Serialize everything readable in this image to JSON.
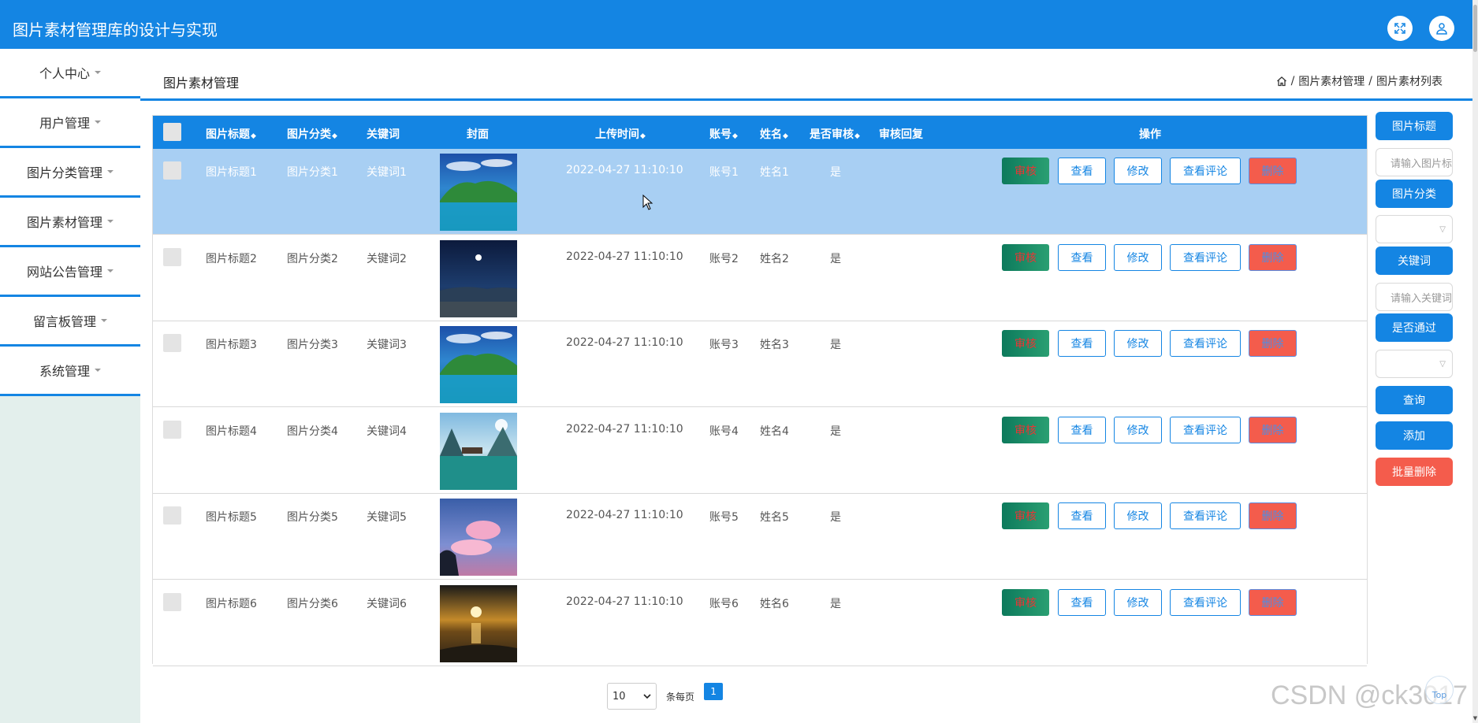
{
  "app": {
    "title": "图片素材管理库的设计与实现"
  },
  "sidebar": {
    "items": [
      {
        "label": "个人中心"
      },
      {
        "label": "用户管理"
      },
      {
        "label": "图片分类管理"
      },
      {
        "label": "图片素材管理"
      },
      {
        "label": "网站公告管理"
      },
      {
        "label": "留言板管理"
      },
      {
        "label": "系统管理"
      }
    ]
  },
  "page": {
    "title": "图片素材管理",
    "breadcrumb": [
      "图片素材管理",
      "图片素材列表"
    ]
  },
  "table": {
    "columns": {
      "title": "图片标题",
      "category": "图片分类",
      "keyword": "关键词",
      "cover": "封面",
      "upload_time": "上传时间",
      "account": "账号",
      "name": "姓名",
      "audited": "是否审核",
      "audit_reply": "审核回复",
      "actions": "操作"
    },
    "sort_glyph": "◆",
    "actions": {
      "audit": "审核",
      "view": "查看",
      "edit": "修改",
      "comments": "查看评论",
      "delete": "删除"
    },
    "rows": [
      {
        "title": "图片标题1",
        "category": "图片分类1",
        "keyword": "关键词1",
        "upload_time": "2022-04-27 11:10:10",
        "account": "账号1",
        "name": "姓名1",
        "audited": "是",
        "cover_theme": "lake-island",
        "selected": true
      },
      {
        "title": "图片标题2",
        "category": "图片分类2",
        "keyword": "关键词2",
        "upload_time": "2022-04-27 11:10:10",
        "account": "账号2",
        "name": "姓名2",
        "audited": "是",
        "cover_theme": "night-sky",
        "selected": false
      },
      {
        "title": "图片标题3",
        "category": "图片分类3",
        "keyword": "关键词3",
        "upload_time": "2022-04-27 11:10:10",
        "account": "账号3",
        "name": "姓名3",
        "audited": "是",
        "cover_theme": "lake-island",
        "selected": false
      },
      {
        "title": "图片标题4",
        "category": "图片分类4",
        "keyword": "关键词4",
        "upload_time": "2022-04-27 11:10:10",
        "account": "账号4",
        "name": "姓名4",
        "audited": "是",
        "cover_theme": "mountain-lake",
        "selected": false
      },
      {
        "title": "图片标题5",
        "category": "图片分类5",
        "keyword": "关键词5",
        "upload_time": "2022-04-27 11:10:10",
        "account": "账号5",
        "name": "姓名5",
        "audited": "是",
        "cover_theme": "pink-clouds",
        "selected": false
      },
      {
        "title": "图片标题6",
        "category": "图片分类6",
        "keyword": "关键词6",
        "upload_time": "2022-04-27 11:10:10",
        "account": "账号6",
        "name": "姓名6",
        "audited": "是",
        "cover_theme": "sunset-beach",
        "selected": false
      }
    ]
  },
  "pagination": {
    "page_size": "10",
    "per_page_label": "条每页",
    "current_page": "1"
  },
  "search_panel": {
    "title_label": "图片标题",
    "title_placeholder": "请输入图片标题",
    "category_label": "图片分类",
    "keyword_label": "关键词",
    "keyword_placeholder": "请输入关键词",
    "passed_label": "是否通过",
    "query_button": "查询",
    "add_button": "添加",
    "batch_delete_button": "批量删除"
  },
  "watermark": "CSDN @ck3017",
  "to_top_label": "Top",
  "colors": {
    "primary": "#1485e3",
    "danger": "#f45c4c",
    "audit": "#0d7a5c",
    "selected_row": "#a8cff3"
  }
}
